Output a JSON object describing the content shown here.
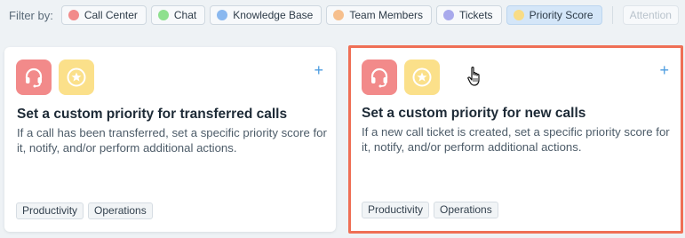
{
  "filter": {
    "label": "Filter by:",
    "chips": [
      {
        "label": "Call Center",
        "color": "#f28b8b"
      },
      {
        "label": "Chat",
        "color": "#8ee08e"
      },
      {
        "label": "Knowledge Base",
        "color": "#8ab8ef"
      },
      {
        "label": "Team Members",
        "color": "#f6bf8d"
      },
      {
        "label": "Tickets",
        "color": "#a8a9ec"
      },
      {
        "label": "Priority Score",
        "color": "#f8dc86",
        "selected": true
      }
    ],
    "attention_label": "Attention"
  },
  "cards": [
    {
      "title": "Set a custom priority for transferred calls",
      "description": "If a call has been transferred, set a specific priority score for it, notify, and/or perform additional actions.",
      "icons": [
        "headset-icon",
        "star-icon"
      ],
      "add_symbol": "+",
      "tags": [
        "Productivity",
        "Operations"
      ],
      "highlighted": false
    },
    {
      "title": "Set a custom priority for new calls",
      "description": "If a new call ticket is created, set a specific priority score for it, notify, and/or perform additional actions.",
      "icons": [
        "headset-icon",
        "star-icon"
      ],
      "add_symbol": "+",
      "tags": [
        "Productivity",
        "Operations"
      ],
      "highlighted": true
    }
  ],
  "colors": {
    "highlight_border": "#ef6f55",
    "accent": "#4d9de0",
    "tile_red": "#f28a8a",
    "tile_yellow": "#fbe08a"
  }
}
